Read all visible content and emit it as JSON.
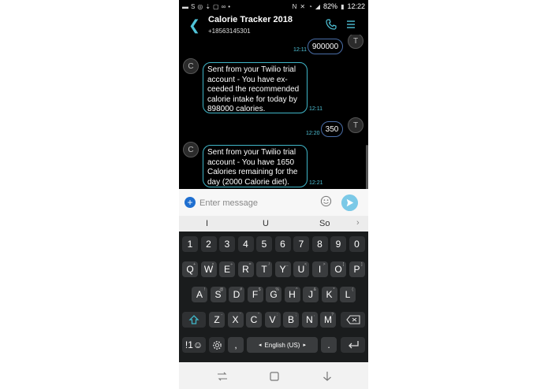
{
  "status_bar": {
    "battery": "82%",
    "time": "12:22"
  },
  "header": {
    "title": "Calorie Tracker 2018",
    "phone_number": "+18563145301"
  },
  "messages": [
    {
      "direction": "out",
      "avatar": "T",
      "text": "900000",
      "time": "12:11"
    },
    {
      "direction": "in",
      "avatar": "C",
      "lines": [
        "Sent from your Twilio trial",
        "account - You have ex-",
        "ceeded the recommended",
        "calorie intake for today by",
        "898000 calories."
      ],
      "time": "12:11"
    },
    {
      "direction": "out",
      "avatar": "T",
      "text": "350",
      "time": "12:20"
    },
    {
      "direction": "in",
      "avatar": "C",
      "lines": [
        "Sent from your Twilio trial",
        "account - You have 1650",
        "Calories remaining for the",
        "day (2000 Calorie diet)."
      ],
      "time": "12:21"
    }
  ],
  "composer": {
    "placeholder": "Enter message"
  },
  "suggestions": [
    "I",
    "U",
    "So"
  ],
  "keyboard": {
    "numbers": [
      "1",
      "2",
      "3",
      "4",
      "5",
      "6",
      "7",
      "8",
      "9",
      "0"
    ],
    "row1": [
      [
        "Q",
        "+"
      ],
      [
        "W",
        "×"
      ],
      [
        "E",
        "÷"
      ],
      [
        "R",
        "="
      ],
      [
        "T",
        "/"
      ],
      [
        "Y",
        "_"
      ],
      [
        "U",
        "<"
      ],
      [
        "I",
        ">"
      ],
      [
        "O",
        "["
      ],
      [
        "P",
        "]"
      ]
    ],
    "row2": [
      [
        "A",
        "!"
      ],
      [
        "S",
        "@"
      ],
      [
        "D",
        "#"
      ],
      [
        "F",
        "$"
      ],
      [
        "G",
        "%"
      ],
      [
        "H",
        "^"
      ],
      [
        "J",
        "&"
      ],
      [
        "K",
        "*"
      ],
      [
        "L",
        "("
      ]
    ],
    "row3": [
      [
        "Z",
        "-"
      ],
      [
        "X",
        "'"
      ],
      [
        "C",
        "\""
      ],
      [
        "V",
        ":"
      ],
      [
        "B",
        ";"
      ],
      [
        "N",
        ","
      ],
      [
        "M",
        "?"
      ]
    ],
    "sym_label": "!1☺",
    "comma": ",",
    "space_label": "English (US)",
    "period": "."
  },
  "colors": {
    "accent": "#4fc3d8",
    "outgoing_border": "#4a6ea8",
    "incoming_border": "#3fb6c8",
    "send_button": "#7bc9e7",
    "attach_button": "#1f6fd0"
  }
}
